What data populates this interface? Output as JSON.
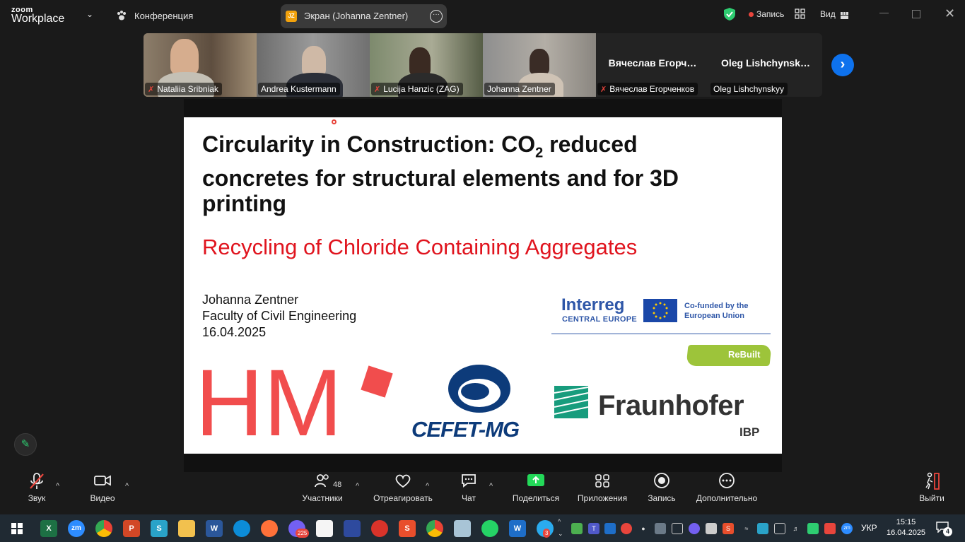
{
  "app": {
    "logo_top": "zoom",
    "logo_bottom": "Workplace",
    "meeting_label": "Конференция",
    "share_title": "Экран (Johanna Zentner)",
    "share_initials": "JZ",
    "recording_label": "Запись",
    "view_label": "Вид"
  },
  "participants": [
    {
      "name": "Nataliia Sribniak",
      "muted": true
    },
    {
      "name": "Andrea Kustermann",
      "muted": false,
      "active": true
    },
    {
      "name": "Lucija Hanzic (ZAG)",
      "muted": true
    },
    {
      "name": "Johanna Zentner",
      "muted": false
    },
    {
      "name": "Вячеслав Егорченков",
      "display": "Вячеслав Егорч…",
      "muted": true
    },
    {
      "name": "Oleg Lishchynskyy",
      "display": "Oleg Lishchynsk…",
      "muted": false
    }
  ],
  "slide": {
    "title_line1_a": "Circularity in Construction: CO",
    "title_sub": "2",
    "title_line1_b": " reduced",
    "title_line2": "concretes for structural elements and for 3D",
    "title_line3": "printing",
    "subtitle": "Recycling of Chloride Containing Aggregates",
    "author": "Johanna Zentner",
    "faculty": "Faculty of Civil Engineering",
    "date": "16.04.2025",
    "logo_hm": "HM",
    "logo_cefet": "CEFET-MG",
    "logo_interreg": "Interreg",
    "logo_central_europe": "CENTRAL EUROPE",
    "logo_cofunded": "Co-funded by the European Union",
    "logo_rebuilt": "ReBuilt",
    "logo_fraunhofer": "Fraunhofer",
    "logo_ibp": "IBP"
  },
  "toolbar": {
    "audio": "Звук",
    "video": "Видео",
    "participants": "Участники",
    "participants_count": "48",
    "react": "Отреагировать",
    "chat": "Чат",
    "share": "Поделиться",
    "apps": "Приложения",
    "record": "Запись",
    "more": "Дополнительно",
    "leave": "Выйти"
  },
  "taskbar": {
    "viber_badge": "225",
    "telegram_badge": "3",
    "language": "УКР",
    "time": "15:15",
    "date": "16.04.2025",
    "notifications": "4"
  },
  "colors": {
    "accent_green": "#2ecc71",
    "zoom_blue": "#0e72ed",
    "slide_red": "#e0141e",
    "hm_red": "#f14d4d"
  }
}
